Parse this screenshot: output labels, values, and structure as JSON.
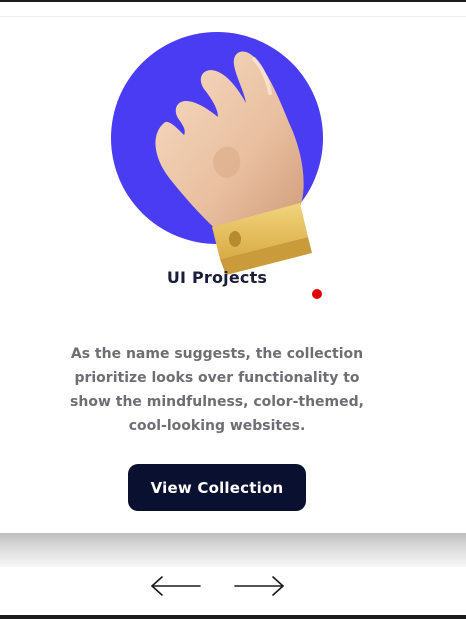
{
  "card": {
    "title": "UI Projects",
    "description": "As the name suggests, the collection prioritize looks over functionality to show the mindfulness, color-themed, cool-looking websites.",
    "cta_label": "View Collection",
    "hero_icon": "hand-icon",
    "status_dot_color": "#e00000"
  },
  "carousel": {
    "prev_icon": "arrow-left-icon",
    "next_icon": "arrow-right-icon"
  },
  "colors": {
    "accent_circle": "#4a3cf2",
    "button_bg": "#0a1130",
    "title_text": "#1b1e3a",
    "body_text": "#6e6e73"
  }
}
